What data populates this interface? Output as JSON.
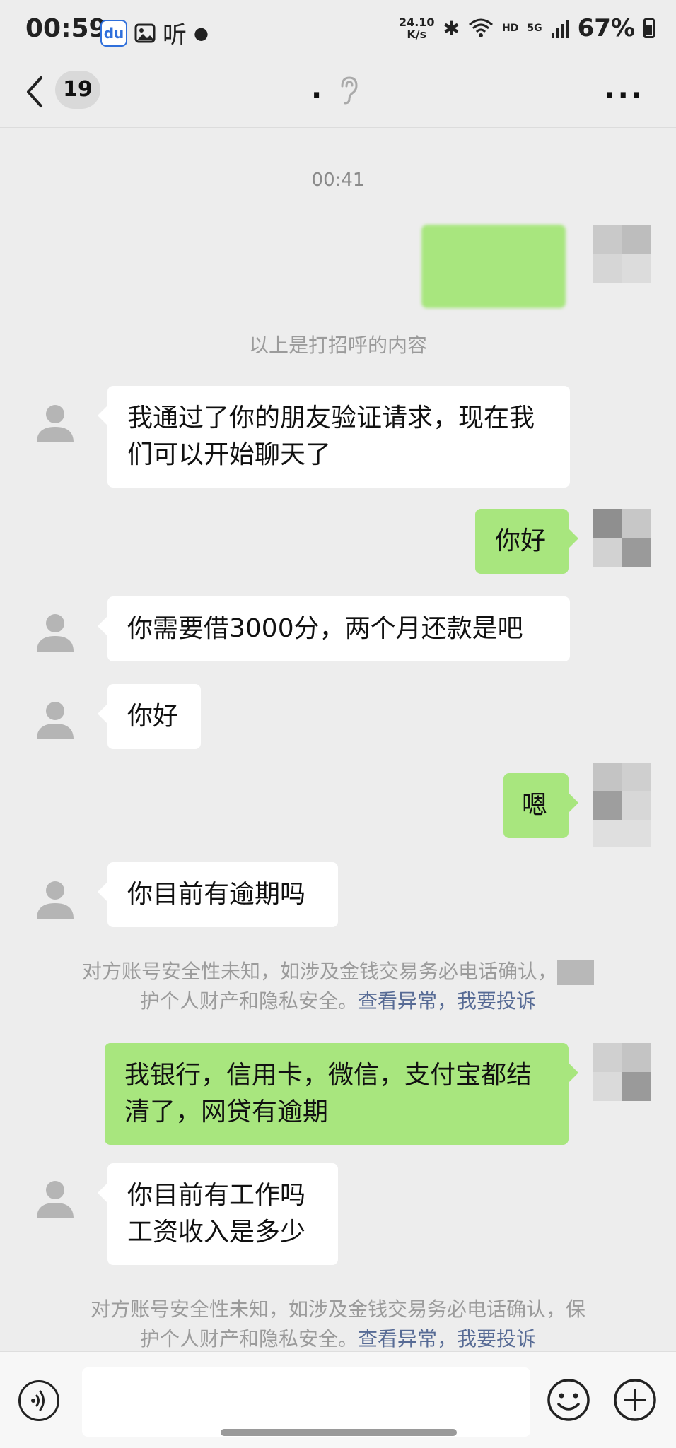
{
  "status_bar": {
    "time": "00:59",
    "left_icons": [
      "baidu-app-icon",
      "image-icon",
      "listen-icon",
      "dot-icon"
    ],
    "listen_text": "听",
    "net_speed_value": "24.10",
    "net_speed_unit": "K/s",
    "hd": "HD",
    "five_g": "5G",
    "battery": "67%"
  },
  "nav": {
    "back_icon": "chevron-left-icon",
    "unread_count": "19",
    "title": ".",
    "title_icon": "ear-icon",
    "more_icon": "more-dots-icon",
    "more_text": "···"
  },
  "chat": {
    "timestamp": "00:41",
    "greeting_note": "以上是打招呼的内容",
    "messages": [
      {
        "side": "left",
        "text_line1": "我通过了你的朋友验证请求，现在我",
        "text_line2": "们可以开始聊天了"
      },
      {
        "side": "right",
        "text": "你好"
      },
      {
        "side": "left",
        "text": "你需要借3000分，两个月还款是吧"
      },
      {
        "side": "left",
        "text": "你好"
      },
      {
        "side": "right",
        "text": "嗯"
      },
      {
        "side": "left",
        "text": "你目前有逾期吗"
      },
      {
        "side": "right",
        "text_line1": "我银行，信用卡，微信，支付宝都结",
        "text_line2": "清了，网贷有逾期"
      },
      {
        "side": "left",
        "text_line1": "你目前有工作吗",
        "text_line2": "工资收入是多少"
      }
    ],
    "warning1": {
      "line1": "对方账号安全性未知，如涉及金钱交易务必电话确认，",
      "line2_prefix": "护个人财产和隐私安全。",
      "link1": "查看异常",
      "sep": "，",
      "link2": "我要投诉"
    },
    "warning2": {
      "line1": "对方账号安全性未知，如涉及金钱交易务必电话确认，保",
      "line2_prefix": "护个人财产和隐私安全。",
      "link1": "查看异常",
      "sep": "，",
      "link2": "我要投诉"
    }
  },
  "input_bar": {
    "voice_icon": "voice-icon",
    "emoji_icon": "emoji-icon",
    "plus_icon": "plus-icon",
    "placeholder": ""
  },
  "colors": {
    "background": "#ededed",
    "bubble_self": "#a8e67e",
    "bubble_other": "#ffffff",
    "link": "#576b95"
  }
}
